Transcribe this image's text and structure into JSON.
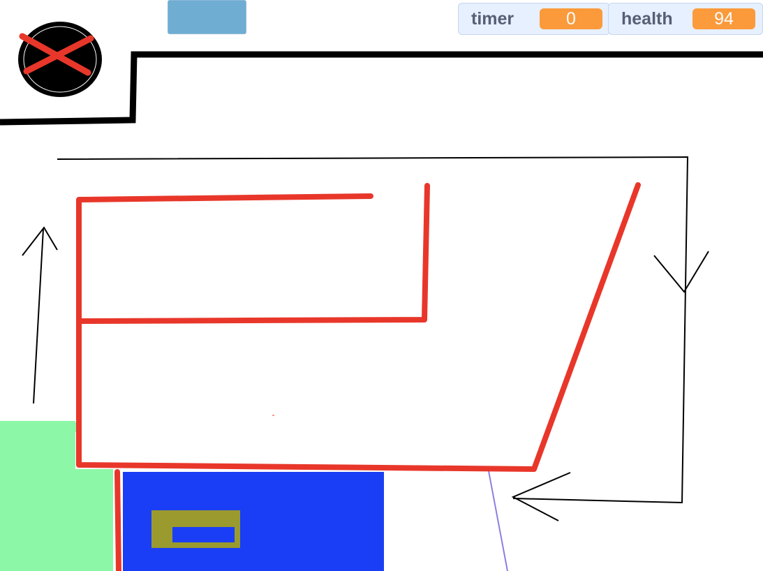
{
  "monitors": {
    "timer": {
      "label": "timer",
      "value": "0"
    },
    "health": {
      "label": "health",
      "value": "94"
    }
  },
  "colors": {
    "monitor_bg": "#e6f0ff",
    "monitor_value": "#ff8c1a",
    "wall_red": "#e8372a",
    "safe_zone": "#8cf7a6",
    "blue_block": "#1a3ef5",
    "olive_block": "#9a9a2e",
    "button_blue": "#6fadd3"
  },
  "icons": {
    "close": "close-x-icon"
  }
}
